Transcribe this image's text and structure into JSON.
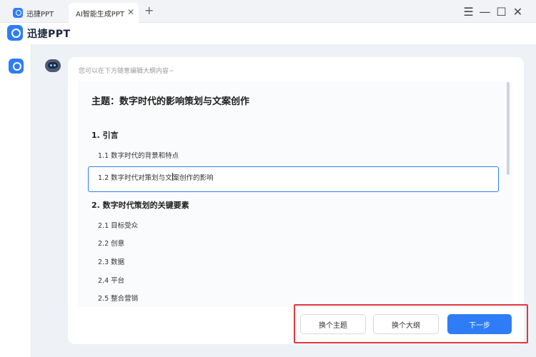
{
  "window": {
    "tabs": [
      {
        "label": "迅捷PPT"
      },
      {
        "label": "AI智能生成PPT"
      }
    ],
    "controls": {
      "menu": "☰",
      "minimize": "—",
      "maximize": "☐",
      "close": "✕"
    }
  },
  "app": {
    "name": "迅捷PPT"
  },
  "assistant": {
    "hint": "您可以在下方随意编辑大纲内容~"
  },
  "outline": {
    "title": "主题：数字时代的影响策划与文案创作",
    "sections": [
      {
        "heading": "1. 引言",
        "items": [
          "1.1 数字时代的背景和特点",
          "1.2 数字时代对策划与文案创作的影响"
        ]
      },
      {
        "heading": "2. 数字时代策划的关键要素",
        "items": [
          "2.1 目标受众",
          "2.2 创意",
          "2.3 数据",
          "2.4 平台",
          "2.5 整合营销"
        ]
      }
    ],
    "editing_before_caret": "1.2 数字时代对策划与文",
    "editing_after_caret": "案创作的影响"
  },
  "actions": {
    "change_topic": "换个主题",
    "change_outline": "换个大纲",
    "next_step": "下一步"
  },
  "colors": {
    "accent": "#2f7df6",
    "highlight_border": "#e0383e"
  }
}
